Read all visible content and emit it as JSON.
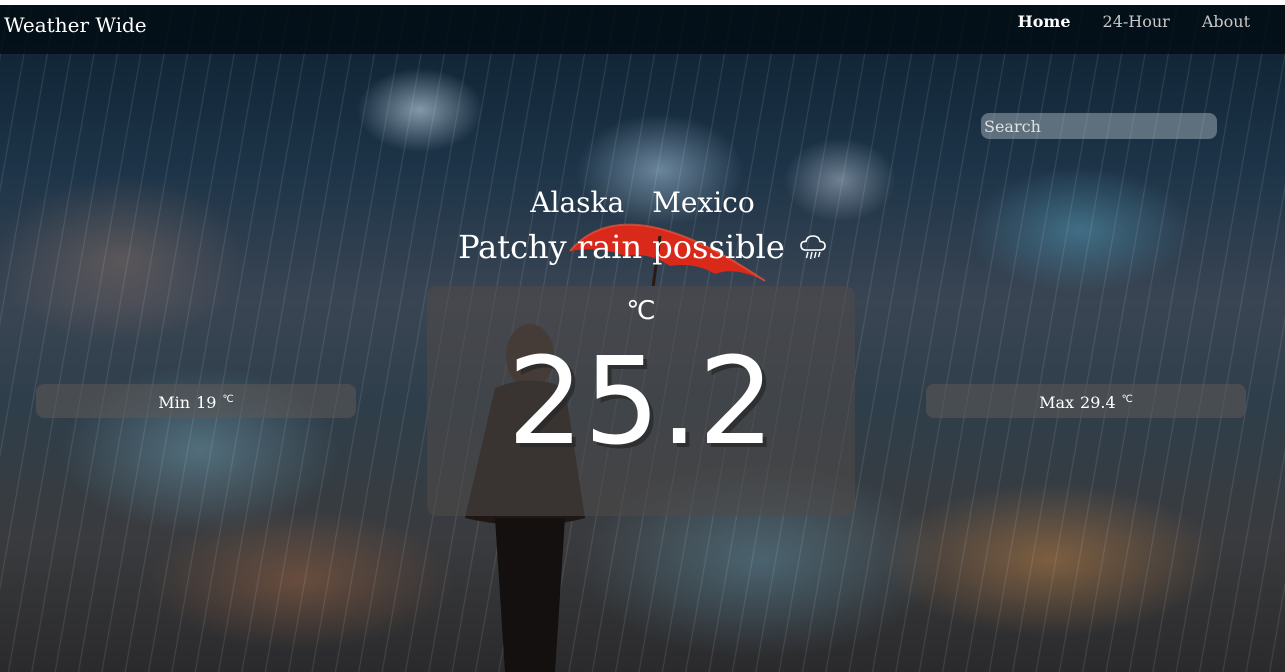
{
  "navbar": {
    "brand": "Weather Wide",
    "links": [
      {
        "label": "Home",
        "active": true
      },
      {
        "label": "24-Hour",
        "active": false
      },
      {
        "label": "About",
        "active": false
      }
    ]
  },
  "search": {
    "placeholder": "Search"
  },
  "location": {
    "region": "Alaska",
    "country": "Mexico"
  },
  "condition": {
    "text": "Patchy rain possible",
    "icon": "rain-cloud-icon"
  },
  "current": {
    "unit": "℃",
    "temperature": "25.2"
  },
  "min": {
    "label": "Min",
    "value": "19",
    "unit": "℃"
  },
  "max": {
    "label": "Max",
    "value": "29.4",
    "unit": "℃"
  },
  "colors": {
    "navbar_bg": "#020c14",
    "accent_umbrella": "#e0301e",
    "text": "#ffffff"
  }
}
